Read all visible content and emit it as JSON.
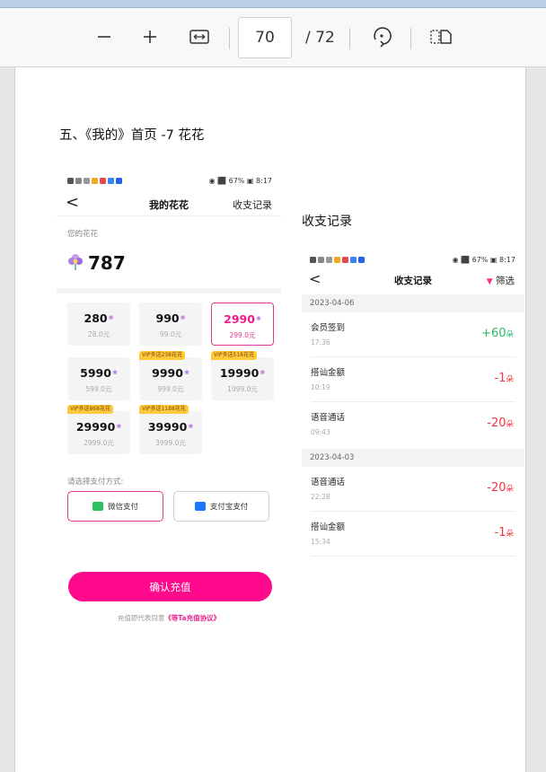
{
  "toolbar": {
    "zoom_out": "—",
    "zoom_in": "+",
    "page_current": "70",
    "page_total": "/ 72"
  },
  "doc": {
    "heading": "五、《我的》首页 -7 花花",
    "section2_label": "收支记录"
  },
  "phone1": {
    "status_right": "◉ ⬛ 67% ▣ 8:17",
    "back": "<",
    "title": "我的花花",
    "nav_right": "收支记录",
    "yours_label": "您的花花",
    "balance": "787",
    "packages": [
      {
        "amount": "280",
        "price": "28.0元",
        "badge": ""
      },
      {
        "amount": "990",
        "price": "99.0元",
        "badge": ""
      },
      {
        "amount": "2990",
        "price": "299.0元",
        "badge": ""
      },
      {
        "amount": "5990",
        "price": "599.0元",
        "badge": ""
      },
      {
        "amount": "9990",
        "price": "999.0元",
        "badge": "VIP多送238花花"
      },
      {
        "amount": "19990",
        "price": "1999.0元",
        "badge": "VIP多送518花花"
      },
      {
        "amount": "29990",
        "price": "2999.0元",
        "badge": "VIP多送868花花"
      },
      {
        "amount": "39990",
        "price": "3999.0元",
        "badge": "VIP多送1188花花"
      }
    ],
    "pay_label": "请选择支付方式:",
    "wechat": "微信支付",
    "alipay": "支付宝支付",
    "confirm": "确认充值",
    "agree_prefix": "充值即代表同意",
    "agree_link": "《等Ta充值协议》"
  },
  "phone2": {
    "status_right": "◉ ⬛ 67% ▣ 8:17",
    "back": "<",
    "title": "收支记录",
    "filter": "筛选",
    "groups": [
      {
        "date": "2023-04-06",
        "records": [
          {
            "name": "会员签到",
            "time": "17:36",
            "amount": "+60",
            "unit": "朵"
          },
          {
            "name": "搭讪金额",
            "time": "10:19",
            "amount": "-1",
            "unit": "朵"
          },
          {
            "name": "语音通话",
            "time": "09:43",
            "amount": "-20",
            "unit": "朵"
          }
        ]
      },
      {
        "date": "2023-04-03",
        "records": [
          {
            "name": "语音通话",
            "time": "22:28",
            "amount": "-20",
            "unit": "朵"
          },
          {
            "name": "搭讪金额",
            "time": "15:34",
            "amount": "-1",
            "unit": "朵"
          }
        ]
      }
    ]
  }
}
